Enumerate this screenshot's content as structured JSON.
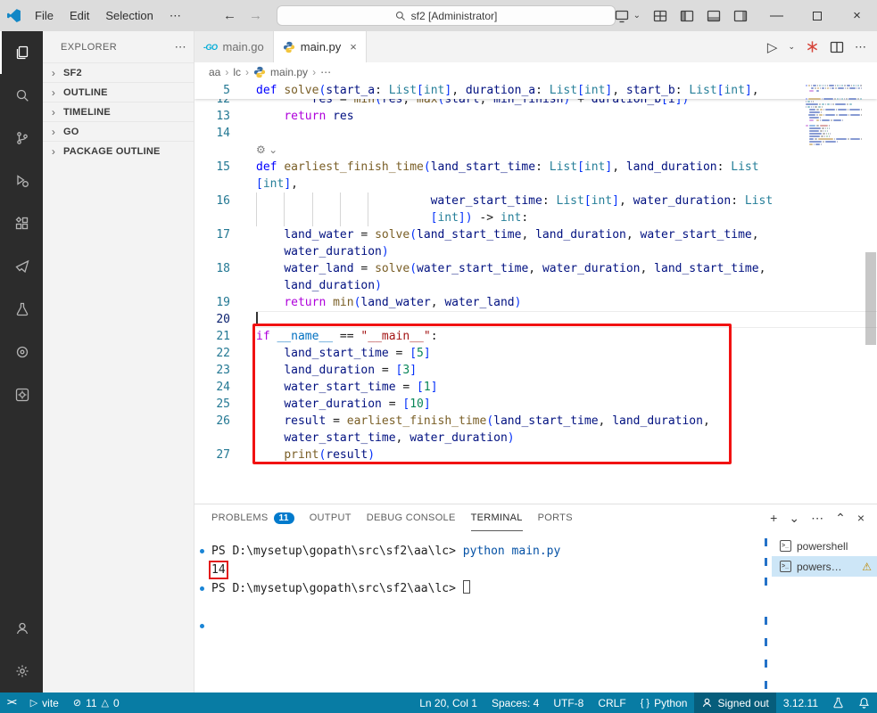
{
  "title_bar": {
    "menus": [
      "File",
      "Edit",
      "Selection",
      "⋯"
    ],
    "search_value": "sf2 [Administrator]",
    "nav_icons": [
      "back",
      "forward"
    ],
    "right_icons": [
      "remote-window",
      "layout-grid",
      "sidebar-left",
      "panel-bottom",
      "sidebar-right"
    ],
    "window_controls": [
      "minimize",
      "maximize",
      "close"
    ]
  },
  "activity_bar": {
    "items": [
      {
        "name": "explorer",
        "active": true
      },
      {
        "name": "search"
      },
      {
        "name": "source-control"
      },
      {
        "name": "run-and-debug"
      },
      {
        "name": "extensions"
      },
      {
        "name": "chat"
      },
      {
        "name": "testing"
      },
      {
        "name": "record"
      },
      {
        "name": "tools"
      }
    ],
    "bottom_items": [
      {
        "name": "accounts"
      },
      {
        "name": "manage"
      }
    ]
  },
  "sidebar": {
    "title": "EXPLORER",
    "more": "⋯",
    "sections": [
      {
        "label": "SF2"
      },
      {
        "label": "OUTLINE"
      },
      {
        "label": "TIMELINE"
      },
      {
        "label": "GO"
      },
      {
        "label": "PACKAGE OUTLINE"
      }
    ]
  },
  "tabs": [
    {
      "label": "main.go",
      "icon": "go",
      "active": false
    },
    {
      "label": "main.py",
      "icon": "python",
      "active": true,
      "close": "×"
    }
  ],
  "editor_actions": [
    "run-python",
    "red-star",
    "split-editor",
    "more"
  ],
  "breadcrumbs": {
    "items": [
      "aa",
      "lc",
      "main.py",
      "⋯"
    ],
    "icon_before_index": 2
  },
  "editor": {
    "sticky": {
      "n": 5,
      "t": [
        [
          "def ",
          "kw"
        ],
        [
          "solve",
          "fn"
        ],
        [
          "(",
          "bk"
        ],
        [
          "start_a",
          "v"
        ],
        [
          ": ",
          "p"
        ],
        [
          "List",
          "ty"
        ],
        [
          "[",
          "bk"
        ],
        [
          "int",
          "ty"
        ],
        [
          "]",
          "bk"
        ],
        [
          ", ",
          "p"
        ],
        [
          "duration_a",
          "v"
        ],
        [
          ": ",
          "p"
        ],
        [
          "List",
          "ty"
        ],
        [
          "[",
          "bk"
        ],
        [
          "int",
          "ty"
        ],
        [
          "]",
          "bk"
        ],
        [
          ", ",
          "p"
        ],
        [
          "start_b",
          "v"
        ],
        [
          ": ",
          "p"
        ],
        [
          "List",
          "ty"
        ],
        [
          "[",
          "bk"
        ],
        [
          "int",
          "ty"
        ],
        [
          "]",
          "bk"
        ],
        [
          ",",
          "p"
        ]
      ]
    },
    "rows": [
      {
        "n": 12,
        "clip": true,
        "t": [
          [
            "        ",
            "ws"
          ],
          [
            "res",
            "v"
          ],
          [
            " = ",
            "p"
          ],
          [
            "min",
            "fn"
          ],
          [
            "(",
            "bk"
          ],
          [
            "res",
            "v"
          ],
          [
            ", ",
            "p"
          ],
          [
            "max",
            "fn"
          ],
          [
            "(",
            "bk"
          ],
          [
            "start",
            "v"
          ],
          [
            ", ",
            "p"
          ],
          [
            "min_finish",
            "v"
          ],
          [
            ")",
            "bk"
          ],
          [
            " + ",
            "p"
          ],
          [
            "duration_b",
            "v"
          ],
          [
            "[",
            "bk"
          ],
          [
            "i",
            "v"
          ],
          [
            "]",
            "bk"
          ],
          [
            ")",
            "bk"
          ]
        ]
      },
      {
        "n": 13,
        "t": [
          [
            "    ",
            "ws"
          ],
          [
            "return",
            "ctrl"
          ],
          [
            " ",
            "ws"
          ],
          [
            "res",
            "v"
          ]
        ]
      },
      {
        "n": 14,
        "t": []
      },
      {
        "gear": true,
        "t": []
      },
      {
        "n": 15,
        "t": [
          [
            "def ",
            "kw"
          ],
          [
            "earliest_finish_time",
            "fn"
          ],
          [
            "(",
            "bk"
          ],
          [
            "land_start_time",
            "v"
          ],
          [
            ": ",
            "p"
          ],
          [
            "List",
            "ty"
          ],
          [
            "[",
            "bk"
          ],
          [
            "int",
            "ty"
          ],
          [
            "]",
            "bk"
          ],
          [
            ", ",
            "p"
          ],
          [
            "land_duration",
            "v"
          ],
          [
            ": ",
            "p"
          ],
          [
            "List",
            "ty"
          ]
        ]
      },
      {
        "t": [
          [
            "[",
            "bk"
          ],
          [
            "int",
            "ty"
          ],
          [
            "]",
            "bk"
          ],
          [
            ",",
            "p"
          ]
        ]
      },
      {
        "n": 16,
        "guides": 5,
        "pad": 5,
        "t": [
          [
            "water_start_time",
            "v"
          ],
          [
            ": ",
            "p"
          ],
          [
            "List",
            "ty"
          ],
          [
            "[",
            "bk"
          ],
          [
            "int",
            "ty"
          ],
          [
            "]",
            "bk"
          ],
          [
            ", ",
            "p"
          ],
          [
            "water_duration",
            "v"
          ],
          [
            ": ",
            "p"
          ],
          [
            "List",
            "ty"
          ]
        ]
      },
      {
        "guides": 5,
        "pad": 5,
        "t": [
          [
            "[",
            "bk"
          ],
          [
            "int",
            "ty"
          ],
          [
            "]",
            "bk"
          ],
          [
            ")",
            "bk"
          ],
          [
            " -> ",
            "p"
          ],
          [
            "int",
            "ty"
          ],
          [
            ":",
            "p"
          ]
        ]
      },
      {
        "n": 17,
        "t": [
          [
            "    ",
            "ws"
          ],
          [
            "land_water",
            "v"
          ],
          [
            " = ",
            "p"
          ],
          [
            "solve",
            "fn"
          ],
          [
            "(",
            "bk"
          ],
          [
            "land_start_time",
            "v"
          ],
          [
            ", ",
            "p"
          ],
          [
            "land_duration",
            "v"
          ],
          [
            ", ",
            "p"
          ],
          [
            "water_start_time",
            "v"
          ],
          [
            ",",
            "p"
          ]
        ]
      },
      {
        "t": [
          [
            "    ",
            "ws"
          ],
          [
            "water_duration",
            "v"
          ],
          [
            ")",
            "bk"
          ]
        ]
      },
      {
        "n": 18,
        "t": [
          [
            "    ",
            "ws"
          ],
          [
            "water_land",
            "v"
          ],
          [
            " = ",
            "p"
          ],
          [
            "solve",
            "fn"
          ],
          [
            "(",
            "bk"
          ],
          [
            "water_start_time",
            "v"
          ],
          [
            ", ",
            "p"
          ],
          [
            "water_duration",
            "v"
          ],
          [
            ", ",
            "p"
          ],
          [
            "land_start_time",
            "v"
          ],
          [
            ",",
            "p"
          ]
        ]
      },
      {
        "t": [
          [
            "    ",
            "ws"
          ],
          [
            "land_duration",
            "v"
          ],
          [
            ")",
            "bk"
          ]
        ]
      },
      {
        "n": 19,
        "t": [
          [
            "    ",
            "ws"
          ],
          [
            "return",
            "ctrl"
          ],
          [
            " ",
            "ws"
          ],
          [
            "min",
            "fn"
          ],
          [
            "(",
            "bk"
          ],
          [
            "land_water",
            "v"
          ],
          [
            ", ",
            "p"
          ],
          [
            "water_land",
            "v"
          ],
          [
            ")",
            "bk"
          ]
        ]
      },
      {
        "n": 20,
        "active": true,
        "cursor": true,
        "t": []
      },
      {
        "n": 21,
        "t": [
          [
            "if ",
            "ctrl"
          ],
          [
            "__name__",
            "cv"
          ],
          [
            " == ",
            "p"
          ],
          [
            "\"__main__\"",
            "s"
          ],
          [
            ":",
            "p"
          ]
        ]
      },
      {
        "n": 22,
        "t": [
          [
            "    ",
            "ws"
          ],
          [
            "land_start_time",
            "v"
          ],
          [
            " = ",
            "p"
          ],
          [
            "[",
            "bk"
          ],
          [
            "5",
            "n"
          ],
          [
            "]",
            "bk"
          ]
        ]
      },
      {
        "n": 23,
        "t": [
          [
            "    ",
            "ws"
          ],
          [
            "land_duration",
            "v"
          ],
          [
            " = ",
            "p"
          ],
          [
            "[",
            "bk"
          ],
          [
            "3",
            "n"
          ],
          [
            "]",
            "bk"
          ]
        ]
      },
      {
        "n": 24,
        "t": [
          [
            "    ",
            "ws"
          ],
          [
            "water_start_time",
            "v"
          ],
          [
            " = ",
            "p"
          ],
          [
            "[",
            "bk"
          ],
          [
            "1",
            "n"
          ],
          [
            "]",
            "bk"
          ]
        ]
      },
      {
        "n": 25,
        "t": [
          [
            "    ",
            "ws"
          ],
          [
            "water_duration",
            "v"
          ],
          [
            " = ",
            "p"
          ],
          [
            "[",
            "bk"
          ],
          [
            "10",
            "n"
          ],
          [
            "]",
            "bk"
          ]
        ]
      },
      {
        "n": 26,
        "t": [
          [
            "    ",
            "ws"
          ],
          [
            "result",
            "v"
          ],
          [
            " = ",
            "p"
          ],
          [
            "earliest_finish_time",
            "fn"
          ],
          [
            "(",
            "bk"
          ],
          [
            "land_start_time",
            "v"
          ],
          [
            ", ",
            "p"
          ],
          [
            "land_duration",
            "v"
          ],
          [
            ",",
            "p"
          ]
        ]
      },
      {
        "t": [
          [
            "    ",
            "ws"
          ],
          [
            "water_start_time",
            "v"
          ],
          [
            ", ",
            "p"
          ],
          [
            "water_duration",
            "v"
          ],
          [
            ")",
            "bk"
          ]
        ]
      },
      {
        "n": 27,
        "t": [
          [
            "    ",
            "ws"
          ],
          [
            "print",
            "fn"
          ],
          [
            "(",
            "bk"
          ],
          [
            "result",
            "v"
          ],
          [
            ")",
            "bk"
          ]
        ]
      }
    ]
  },
  "panel": {
    "tabs": [
      {
        "label": "PROBLEMS",
        "badge": "11"
      },
      {
        "label": "OUTPUT"
      },
      {
        "label": "DEBUG CONSOLE"
      },
      {
        "label": "TERMINAL",
        "active": true
      },
      {
        "label": "PORTS"
      }
    ],
    "actions": [
      "new-terminal",
      "profile-dropdown",
      "more",
      "maximize-panel",
      "close-panel"
    ]
  },
  "terminal": {
    "lines": [
      {
        "dot": true,
        "segments": [
          [
            "PS D:\\mysetup\\gopath\\src\\sf2\\aa\\lc> ",
            ""
          ],
          [
            "python main.py",
            "cmd"
          ]
        ]
      },
      {
        "segments": [
          [
            "14",
            "boxed"
          ]
        ]
      },
      {
        "dot": true,
        "cursor": true,
        "segments": [
          [
            "PS D:\\mysetup\\gopath\\src\\sf2\\aa\\lc> ",
            ""
          ]
        ]
      },
      {
        "segments": []
      },
      {
        "dot": true,
        "segments": []
      }
    ],
    "side_items": [
      {
        "label": "powershell"
      },
      {
        "label": "powers…",
        "selected": true,
        "warning": "⚠"
      }
    ]
  },
  "status_bar": {
    "left": [
      {
        "name": "remote-indicator",
        "icon": "remote"
      },
      {
        "name": "run-task-vite",
        "icon": "play",
        "label": "vite"
      },
      {
        "name": "problems-status",
        "icon": "error",
        "label": "11",
        "icon2": "warning",
        "label2": "0"
      }
    ],
    "right": [
      {
        "name": "cursor-position",
        "label": "Ln 20, Col 1"
      },
      {
        "name": "indentation",
        "label": "Spaces: 4"
      },
      {
        "name": "encoding",
        "label": "UTF-8"
      },
      {
        "name": "eol",
        "label": "CRLF"
      },
      {
        "name": "language-mode",
        "icon": "braces",
        "label": "Python"
      },
      {
        "name": "signed-out",
        "icon": "person",
        "label": "Signed out",
        "highlight": true
      },
      {
        "name": "python-version",
        "label": "3.12.11"
      },
      {
        "name": "beaker",
        "icon": "beaker"
      },
      {
        "name": "notifications",
        "icon": "bell"
      }
    ]
  },
  "colors": {
    "accent": "#087ca4",
    "badge": "#007acc",
    "annotation": "#f11212"
  }
}
